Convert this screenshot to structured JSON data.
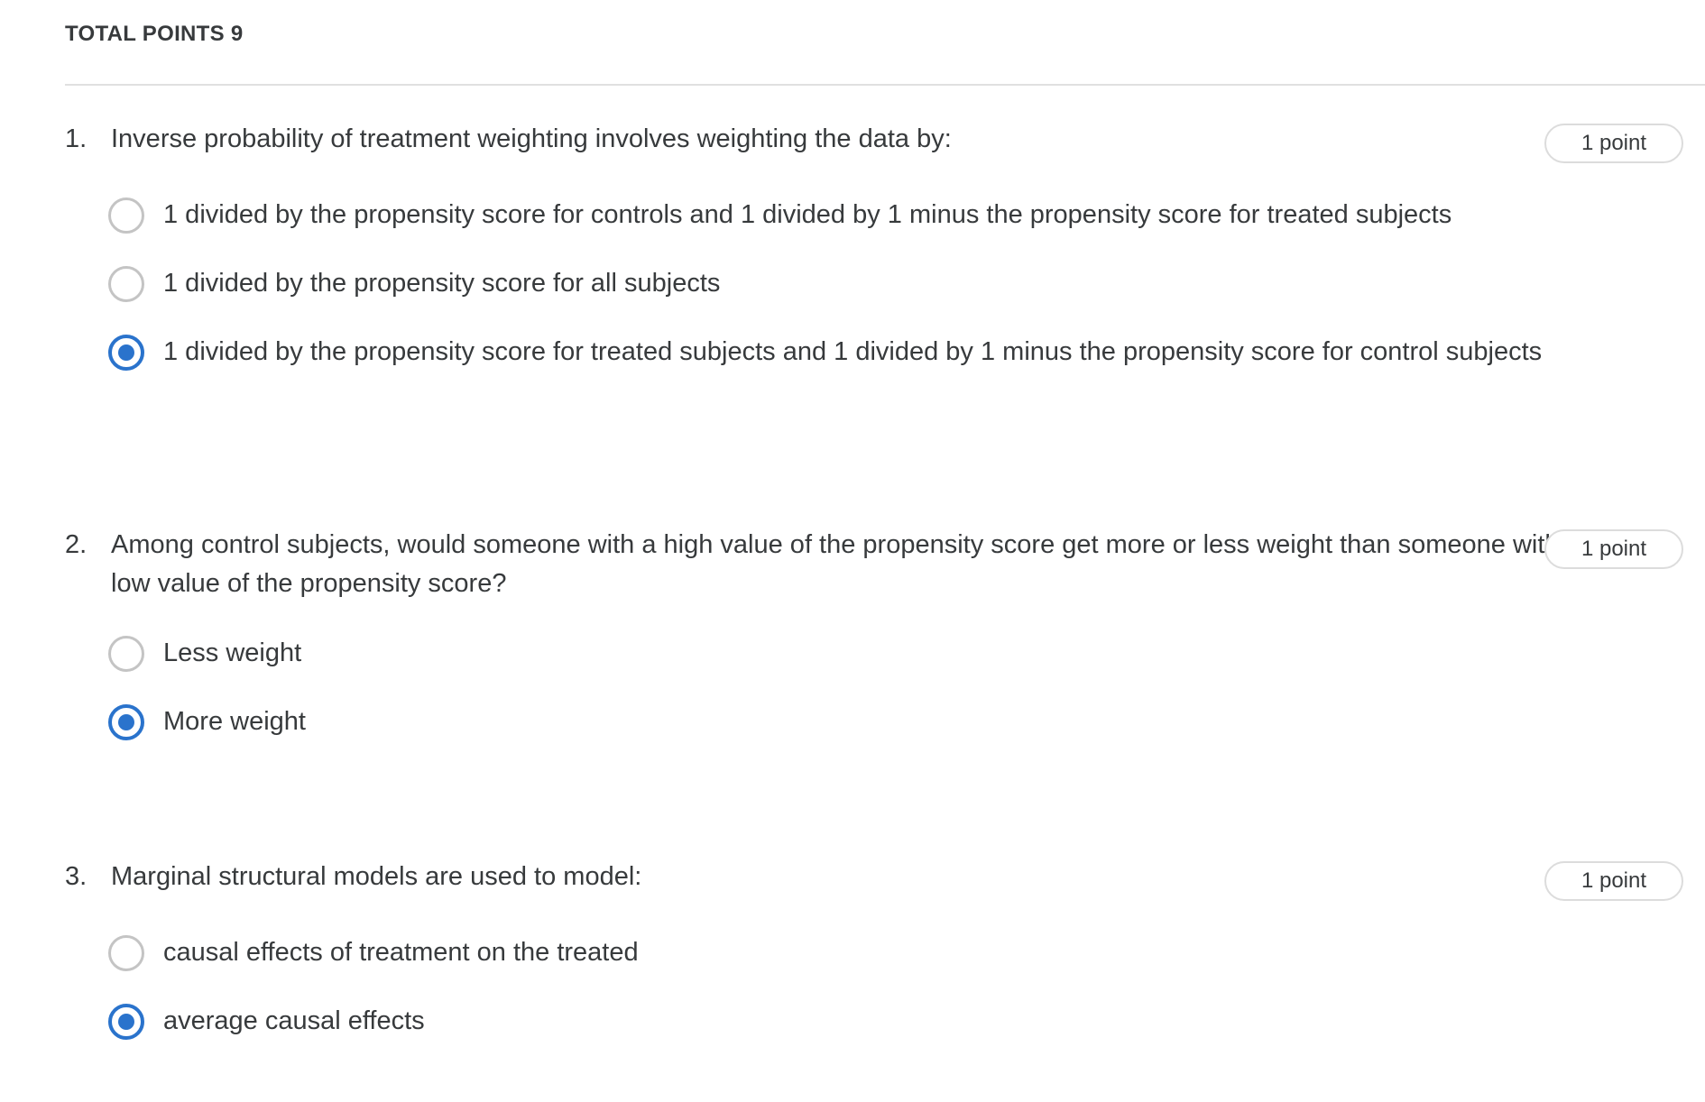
{
  "header": {
    "total_points": "TOTAL POINTS 9"
  },
  "questions": [
    {
      "number": "1.",
      "text": "Inverse probability of treatment weighting involves weighting the data by:",
      "points": "1 point",
      "options": [
        {
          "label": "1 divided by the propensity score for controls and 1 divided by 1 minus the propensity score for treated subjects",
          "selected": false
        },
        {
          "label": "1 divided by the propensity score for all subjects",
          "selected": false
        },
        {
          "label": "1 divided by the propensity score for treated subjects and 1 divided by 1 minus the propensity score for control subjects",
          "selected": true
        }
      ]
    },
    {
      "number": "2.",
      "text": "Among control subjects, would someone with a high value of the propensity score get more or less weight than someone with a low value of the propensity score?",
      "points": "1 point",
      "options": [
        {
          "label": "Less weight",
          "selected": false
        },
        {
          "label": "More weight",
          "selected": true
        }
      ]
    },
    {
      "number": "3.",
      "text": "Marginal structural models are used to model:",
      "points": "1 point",
      "options": [
        {
          "label": "causal effects of treatment on the treated",
          "selected": false
        },
        {
          "label": "average causal effects",
          "selected": true
        }
      ]
    }
  ],
  "colors": {
    "accent": "#2a73cc",
    "text": "#373a3c",
    "radio_border": "#c4c4c4",
    "divider": "#e0e0e0"
  }
}
